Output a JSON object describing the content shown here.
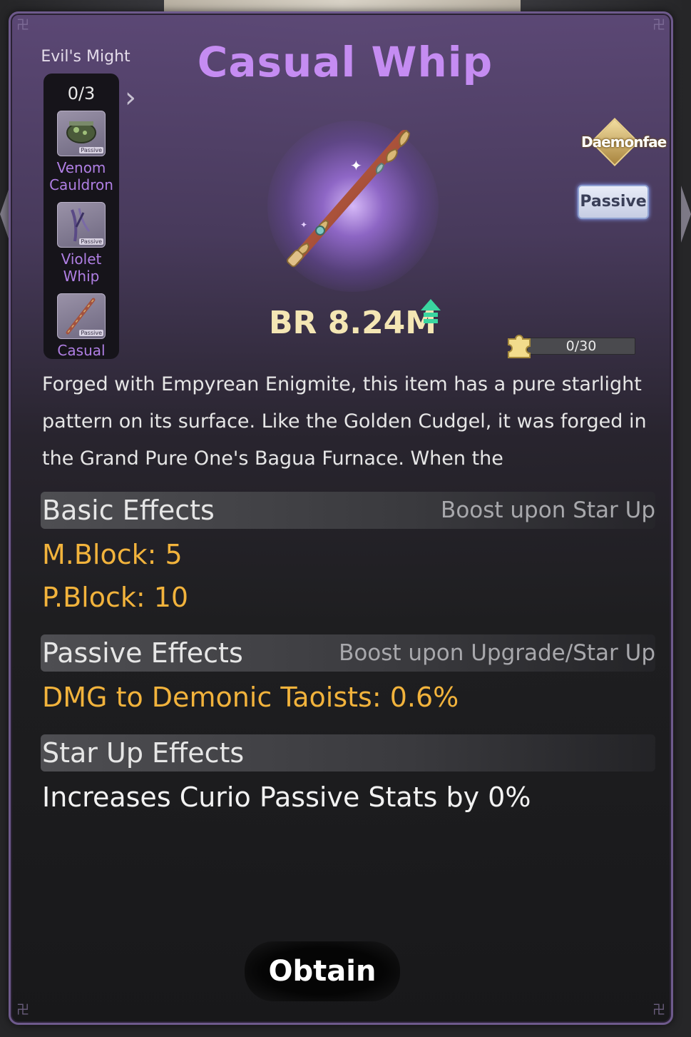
{
  "item": {
    "title": "Casual Whip",
    "br_label": "BR 8.24M",
    "faction_badge": "Daemonfae",
    "type_badge": "Passive",
    "fragments_text": "0/30",
    "fragments_progress": 0,
    "description": "Forged with Empyrean Enigmite, this item has a pure starlight pattern on its surface. Like the Golden Cudgel, it was forged in the Grand Pure One's Bagua Furnace. When the"
  },
  "set": {
    "label": "Evil's Might",
    "count": "0/3",
    "items": [
      {
        "name": "Venom Cauldron",
        "tag": "Passive"
      },
      {
        "name": "Violet Whip",
        "tag": "Passive"
      },
      {
        "name": "Casual",
        "tag": "Passive"
      }
    ]
  },
  "basic_effects": {
    "title": "Basic Effects",
    "hint": "Boost upon Star Up",
    "stats": [
      "M.Block: 5",
      "P.Block: 10"
    ]
  },
  "passive_effects": {
    "title": "Passive Effects",
    "hint": "Boost upon Upgrade/Star Up",
    "stats": [
      "DMG to Demonic Taoists: 0.6%"
    ]
  },
  "star_up_effects": {
    "title": "Star Up Effects",
    "text": "Increases Curio Passive Stats by 0%"
  },
  "actions": {
    "obtain": "Obtain"
  },
  "colors": {
    "title": "#c58cf2",
    "stat": "#f2b33c",
    "set_name": "#b07fe4",
    "br": "#f4e6b4",
    "up_arrow": "#3ad6a0"
  }
}
